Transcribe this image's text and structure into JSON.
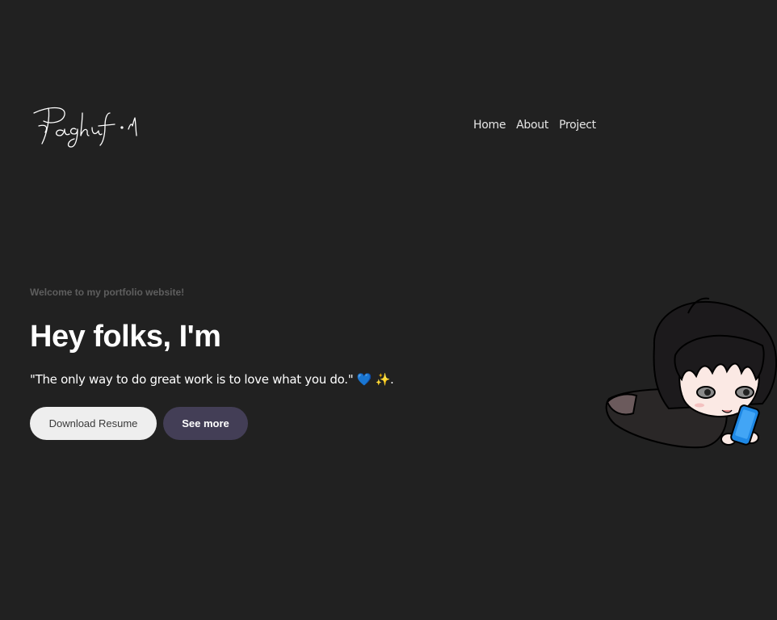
{
  "header": {
    "logo_text": "Paghuf · M",
    "nav": [
      {
        "label": "Home"
      },
      {
        "label": "About"
      },
      {
        "label": "Project"
      }
    ]
  },
  "hero": {
    "welcome": "Welcome to my portfolio website!",
    "headline": "Hey folks, I'm",
    "quote": "\"The only way to do great work is to love what you do.\"",
    "quote_emoji_heart": "💙",
    "quote_emoji_sparkle": "✨",
    "quote_end": ".",
    "buttons": {
      "primary_label": "Download Resume",
      "secondary_label": "See more"
    }
  },
  "icons": [
    "signature-logo",
    "chibi-avatar-icon",
    "blue-heart-icon",
    "sparkles-icon"
  ],
  "colors": {
    "background": "#212121",
    "text": "#ffffff",
    "muted": "#5e5e5e",
    "button_light": "#eeeeee",
    "button_dark": "#433e56",
    "accent_blue": "#1e88e5"
  }
}
